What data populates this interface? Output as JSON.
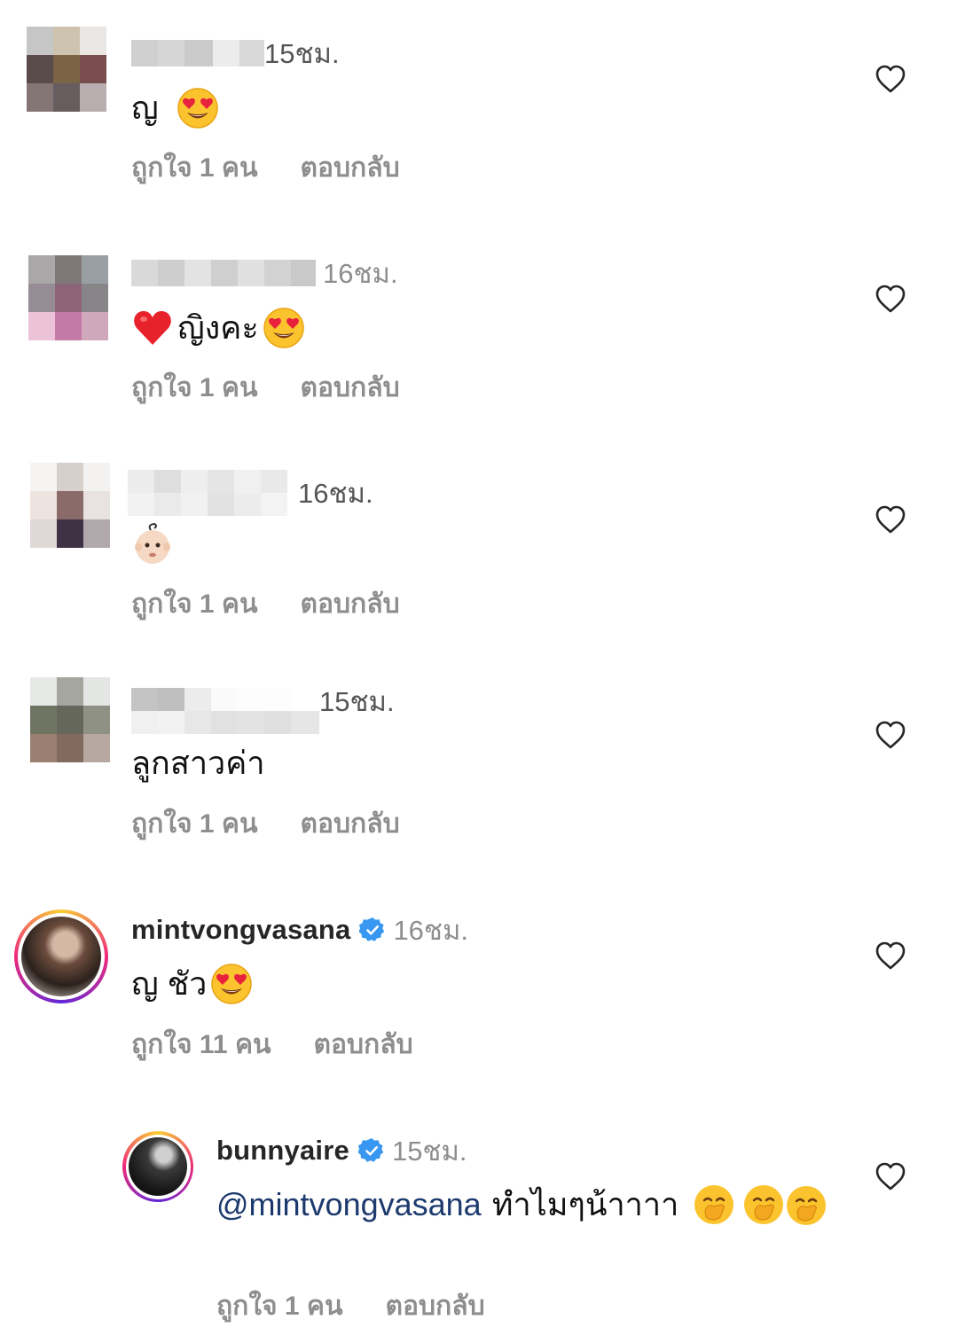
{
  "comments": [
    {
      "time": "15ชม.",
      "text": "ญ",
      "likes": "ถูกใจ 1 คน",
      "reply": "ตอบกลับ"
    },
    {
      "time": "16ชม.",
      "text": "ญิงคะ",
      "likes": "ถูกใจ 1 คน",
      "reply": "ตอบกลับ"
    },
    {
      "time": "16ชม.",
      "text": "",
      "likes": "ถูกใจ 1 คน",
      "reply": "ตอบกลับ"
    },
    {
      "time": "15ชม.",
      "text": "ลูกสาวค่า",
      "likes": "ถูกใจ 1 คน",
      "reply": "ตอบกลับ"
    },
    {
      "username": "mintvongvasana",
      "time": "16ชม.",
      "text": "ญ ชัว",
      "likes": "ถูกใจ 11 คน",
      "reply": "ตอบกลับ"
    },
    {
      "username": "bunnyaire",
      "time": "15ชม.",
      "mention": "@mintvongvasana",
      "text": "ทำไมๆน้าาาา",
      "likes": "ถูกใจ 1 คน",
      "reply": "ตอบกลับ"
    }
  ],
  "icons": {
    "heart": "heart-outline-icon",
    "verified": "verified-badge-icon",
    "emoji_heart_eyes": "heart-eyes-emoji",
    "emoji_red_heart": "red-heart-emoji",
    "emoji_baby": "baby-emoji",
    "emoji_hand_over_mouth": "hand-over-mouth-emoji"
  },
  "colors": {
    "muted": "#8e8e8e",
    "verified": "#3897f0",
    "mention": "#1d3a6e",
    "story_ring": [
      "#f9ce34",
      "#ee2a7b",
      "#6228d7"
    ]
  }
}
